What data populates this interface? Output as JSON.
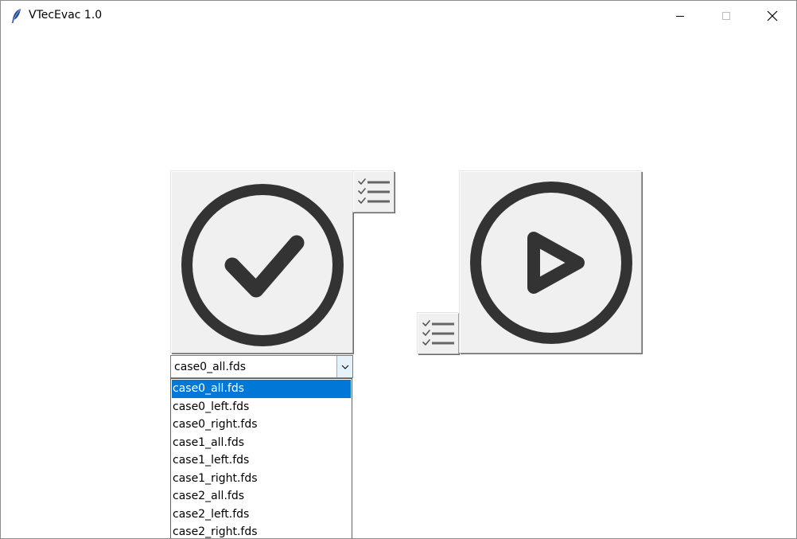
{
  "window": {
    "title": "VTecEvac 1.0",
    "icon": "feather-icon",
    "controls": [
      "minimize-icon",
      "maximize-icon",
      "close-icon"
    ]
  },
  "buttons": {
    "check": {
      "icon": "check-circle-icon"
    },
    "run": {
      "icon": "play-circle-icon"
    },
    "list_top": {
      "icon": "checklist-icon"
    },
    "list_bottom": {
      "icon": "checklist-icon"
    }
  },
  "combobox": {
    "selected": "case0_all.fds",
    "options": [
      "case0_all.fds",
      "case0_left.fds",
      "case0_right.fds",
      "case1_all.fds",
      "case1_left.fds",
      "case1_right.fds",
      "case2_all.fds",
      "case2_left.fds",
      "case2_right.fds"
    ],
    "highlighted_index": 0
  },
  "colors": {
    "highlight": "#0078d7",
    "icon_dark": "#333333",
    "button_face": "#f0f0f0"
  }
}
